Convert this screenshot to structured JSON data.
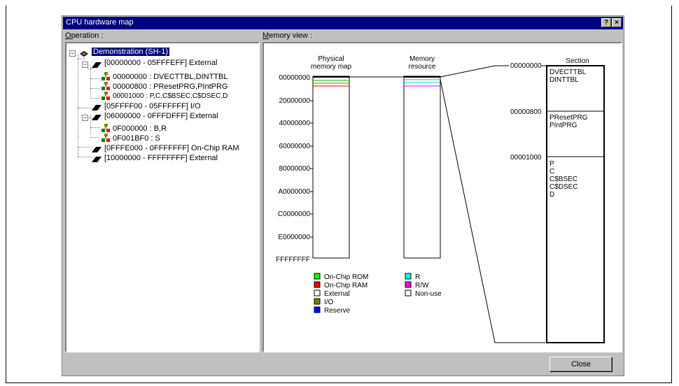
{
  "window": {
    "title": "CPU hardware map",
    "help_label": "?",
    "close_label": "×"
  },
  "left_label": {
    "underlined": "O",
    "rest": "peration :"
  },
  "right_label": {
    "underlined": "M",
    "rest": "emory view :"
  },
  "tree": {
    "root": "Demonstration (SH-1)",
    "items": [
      "[00000000 - 05FFFEFF] External",
      "00000000 : DVECTTBL,DINTTBL",
      "00000800 : PResetPRG,PIntPRG",
      "00001000 : P,C,C$BSEC,C$DSEC,D",
      "[05FFFF00 - 05FFFFFF] I/O",
      "[06000000 - 0FFFDFFF] External",
      "0F000000 : B,R",
      "0F001BF0 : S",
      "[0FFFE000 - 0FFFFFFF] On-Chip RAM",
      "[10000000 - FFFFFFFF] External"
    ]
  },
  "memory_view": {
    "physical_title": [
      "Physical",
      "memory map"
    ],
    "resource_title": [
      "Memory",
      "resource"
    ],
    "section_title": "Section",
    "axis_labels": [
      "00000000",
      "20000000",
      "40000000",
      "60000000",
      "80000000",
      "A0000000",
      "C0000000",
      "E0000000",
      "FFFFFFFF"
    ],
    "section_addresses": [
      "00000000",
      "00000800",
      "00001000"
    ],
    "sections": [
      [
        "DVECTTBL",
        "DINTTBL"
      ],
      [
        "PResetPRG",
        "PIntPRG"
      ],
      [
        "P",
        "C",
        "C$BSEC",
        "C$DSEC",
        "D"
      ]
    ],
    "legend_physical": [
      {
        "label": "On-Chip ROM",
        "color": "#00ff00"
      },
      {
        "label": "On-Chip RAM",
        "color": "#ff0000"
      },
      {
        "label": "External",
        "color": "#ffffff"
      },
      {
        "label": "I/O",
        "color": "#808000"
      },
      {
        "label": "Reserve",
        "color": "#0000ff"
      }
    ],
    "legend_resource": [
      {
        "label": "R",
        "color": "#00ffff"
      },
      {
        "label": "R/W",
        "color": "#ff00ff"
      },
      {
        "label": "Non-use",
        "color": "#ffffff"
      }
    ]
  },
  "close_button": "Close"
}
